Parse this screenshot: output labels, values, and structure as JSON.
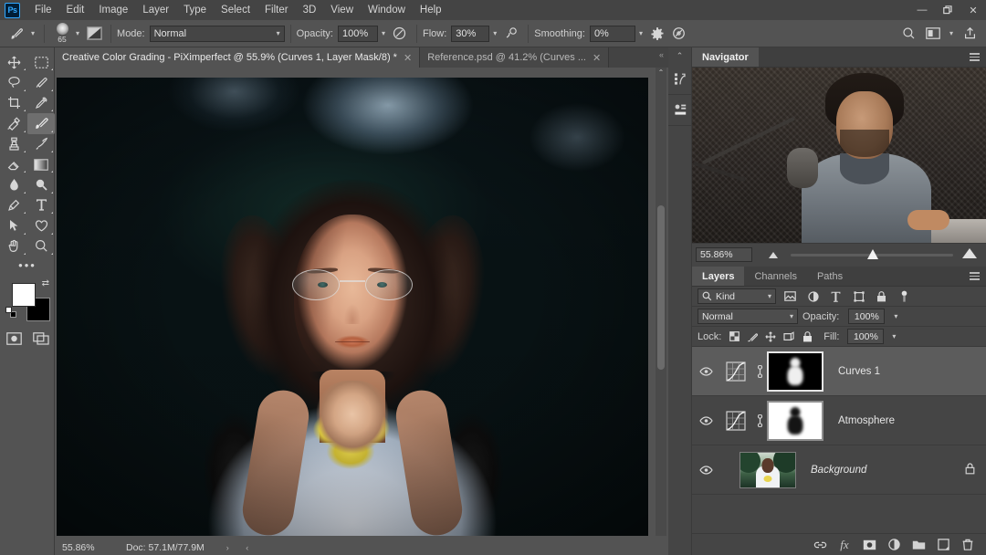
{
  "app": {
    "name": "Adobe Photoshop",
    "logo_text": "Ps"
  },
  "menubar": {
    "items": [
      "File",
      "Edit",
      "Image",
      "Layer",
      "Type",
      "Select",
      "Filter",
      "3D",
      "View",
      "Window",
      "Help"
    ],
    "window_controls": {
      "minimize": "—",
      "restore": "❐",
      "close": "✕"
    }
  },
  "options_bar": {
    "tool_icon": "brush-tool-icon",
    "brush_size": "65",
    "mode_label": "Mode:",
    "mode_value": "Normal",
    "opacity_label": "Opacity:",
    "opacity_value": "100%",
    "flow_label": "Flow:",
    "flow_value": "30%",
    "smoothing_label": "Smoothing:",
    "smoothing_value": "0%",
    "right_icons": [
      "search-icon",
      "workspace-icon",
      "share-icon"
    ]
  },
  "toolbar": {
    "tools": [
      {
        "name": "move-tool",
        "selected": false
      },
      {
        "name": "rectangular-marquee-tool",
        "selected": false
      },
      {
        "name": "lasso-tool",
        "selected": false
      },
      {
        "name": "quick-selection-tool",
        "selected": false
      },
      {
        "name": "crop-tool",
        "selected": false
      },
      {
        "name": "eyedropper-tool",
        "selected": false
      },
      {
        "name": "spot-healing-brush-tool",
        "selected": false
      },
      {
        "name": "brush-tool",
        "selected": true
      },
      {
        "name": "clone-stamp-tool",
        "selected": false
      },
      {
        "name": "history-brush-tool",
        "selected": false
      },
      {
        "name": "eraser-tool",
        "selected": false
      },
      {
        "name": "gradient-tool",
        "selected": false
      },
      {
        "name": "blur-tool",
        "selected": false
      },
      {
        "name": "dodge-tool",
        "selected": false
      },
      {
        "name": "pen-tool",
        "selected": false
      },
      {
        "name": "type-tool",
        "selected": false
      },
      {
        "name": "path-selection-tool",
        "selected": false
      },
      {
        "name": "shape-tool",
        "selected": false
      },
      {
        "name": "hand-tool",
        "selected": false
      },
      {
        "name": "zoom-tool",
        "selected": false
      }
    ],
    "edit_toolbar_label": "•••",
    "foreground_color": "#ffffff",
    "background_color": "#000000"
  },
  "document_tabs": [
    {
      "title": "Creative Color Grading - PiXimperfect @ 55.9% (Curves 1, Layer Mask/8) *",
      "active": true,
      "close": "✕"
    },
    {
      "title": "Reference.psd @ 41.2% (Curves ...",
      "active": false,
      "close": "✕"
    }
  ],
  "status_bar": {
    "zoom": "55.86%",
    "doc_info": "Doc: 57.1M/77.9M",
    "arrows": "› ‹"
  },
  "navigator": {
    "tab_label": "Navigator",
    "zoom_value": "55.86%",
    "menu_icon": "panel-menu-icon",
    "zoom_out_icon": "zoom-out-triangle-icon",
    "zoom_in_icon": "zoom-in-triangle-icon",
    "slider_knob": "zoom-slider-knob"
  },
  "dock_rail": {
    "collapse_icon": "collapse-panels-icon",
    "icons": [
      "history-panel-icon",
      "properties-panel-icon"
    ]
  },
  "layers_panel": {
    "tabs": [
      {
        "label": "Layers",
        "active": true
      },
      {
        "label": "Channels",
        "active": false
      },
      {
        "label": "Paths",
        "active": false
      }
    ],
    "filter_label": "Kind",
    "filter_icons": [
      "pixel-layer-filter-icon",
      "adjustment-layer-filter-icon",
      "type-layer-filter-icon",
      "shape-layer-filter-icon",
      "smart-object-filter-icon",
      "filter-toggle-icon"
    ],
    "blend_mode": "Normal",
    "opacity_label": "Opacity:",
    "opacity_value": "100%",
    "lock_label": "Lock:",
    "lock_icons": [
      "lock-transparent-pixels-icon",
      "lock-image-pixels-icon",
      "lock-position-icon",
      "lock-artboard-nesting-icon",
      "lock-all-icon"
    ],
    "fill_label": "Fill:",
    "fill_value": "100%",
    "layers": [
      {
        "name": "Curves 1",
        "visible": true,
        "selected": true,
        "type": "adjustment",
        "mask": "dark",
        "linked": true,
        "locked": false
      },
      {
        "name": "Atmosphere",
        "visible": true,
        "selected": false,
        "type": "adjustment",
        "mask": "light",
        "linked": true,
        "locked": false
      },
      {
        "name": "Background",
        "visible": true,
        "selected": false,
        "type": "image",
        "mask": "none",
        "linked": false,
        "locked": true
      }
    ],
    "footer_icons": [
      "link-layers-icon",
      "layer-style-fx-icon",
      "add-layer-mask-icon",
      "new-adjustment-layer-icon",
      "new-group-icon",
      "new-layer-icon",
      "delete-layer-icon"
    ],
    "fx_label": "fx"
  },
  "canvas": {
    "scrollbar_vertical": "canvas-vertical-scrollbar",
    "scrollbar_horizontal": "canvas-horizontal-scrollbar"
  },
  "colors": {
    "chrome": "#535353",
    "panel": "#454545",
    "menubar": "#444444",
    "accent_blue": "#31a8ff",
    "selected_row": "#5c5c5c"
  }
}
